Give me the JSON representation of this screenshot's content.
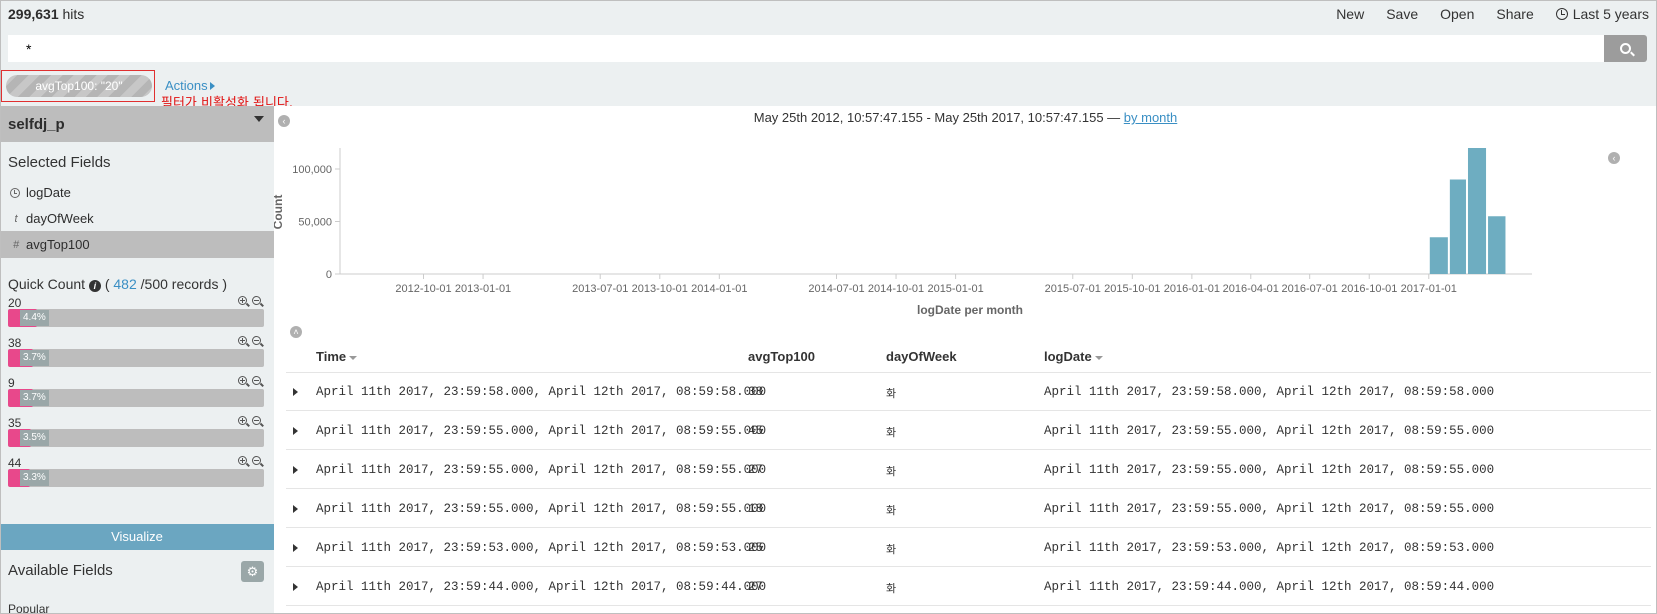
{
  "header": {
    "hits_count": "299,631",
    "hits_label": " hits",
    "nav": {
      "new": "New",
      "save": "Save",
      "open": "Open",
      "share": "Share",
      "time": "Last 5 years"
    }
  },
  "search": {
    "query": "*"
  },
  "filter": {
    "pill_label": "avgTop100: \"20\"",
    "actions_label": "Actions",
    "notice": "필터가 비활성화 됩니다."
  },
  "sidebar": {
    "index_name": "selfdj_p",
    "selected_title": "Selected Fields",
    "selected_fields": [
      {
        "name": "logDate",
        "type_icon": "clock-icon"
      },
      {
        "name": "dayOfWeek",
        "type_icon": "t"
      },
      {
        "name": "avgTop100",
        "type_icon": "#"
      }
    ],
    "quick_count": {
      "title": "Quick Count",
      "open": " ( ",
      "count": "482",
      "rest": " /500 records )"
    },
    "values": [
      {
        "label": "20",
        "pct": "4.4%",
        "fraction": 0.044
      },
      {
        "label": "38",
        "pct": "3.7%",
        "fraction": 0.037
      },
      {
        "label": "9",
        "pct": "3.7%",
        "fraction": 0.037
      },
      {
        "label": "35",
        "pct": "3.5%",
        "fraction": 0.035
      },
      {
        "label": "44",
        "pct": "3.3%",
        "fraction": 0.033
      }
    ],
    "visualize_label": "Visualize",
    "available_title": "Available Fields",
    "popular_label": "Popular"
  },
  "main": {
    "range_text": "May 25th 2012, 10:57:47.155 - May 25th 2017, 10:57:47.155 — ",
    "interval_link": "by month"
  },
  "chart_data": {
    "type": "bar",
    "xlabel": "logDate per month",
    "ylabel": "Count",
    "ylim": [
      0,
      120000
    ],
    "yticks": [
      0,
      50000,
      100000
    ],
    "ytick_labels": [
      "0",
      "50,000",
      "100,000"
    ],
    "xticks": [
      "2012-10-01",
      "2013-01-01",
      "2013-07-01",
      "2013-10-01",
      "2014-01-01",
      "2014-07-01",
      "2014-10-01",
      "2015-01-01",
      "2015-07-01",
      "2015-10-01",
      "2016-01-01",
      "2016-04-01",
      "2016-07-01",
      "2016-10-01",
      "2017-01-01"
    ],
    "categories": [
      "2017-01",
      "2017-02",
      "2017-03",
      "2017-04"
    ],
    "values": [
      35000,
      90000,
      120000,
      55000
    ],
    "color": "#6eadc1",
    "grid": false
  },
  "table": {
    "headers": {
      "time": "Time",
      "avgTop100": "avgTop100",
      "dayOfWeek": "dayOfWeek",
      "logDate": "logDate"
    },
    "rows": [
      {
        "time": "April 11th 2017, 23:59:58.000, April 12th 2017, 08:59:58.000",
        "avgTop100": "38",
        "dayOfWeek": "화",
        "logDate": "April 11th 2017, 23:59:58.000, April 12th 2017, 08:59:58.000"
      },
      {
        "time": "April 11th 2017, 23:59:55.000, April 12th 2017, 08:59:55.000",
        "avgTop100": "45",
        "dayOfWeek": "화",
        "logDate": "April 11th 2017, 23:59:55.000, April 12th 2017, 08:59:55.000"
      },
      {
        "time": "April 11th 2017, 23:59:55.000, April 12th 2017, 08:59:55.000",
        "avgTop100": "27",
        "dayOfWeek": "화",
        "logDate": "April 11th 2017, 23:59:55.000, April 12th 2017, 08:59:55.000"
      },
      {
        "time": "April 11th 2017, 23:59:55.000, April 12th 2017, 08:59:55.000",
        "avgTop100": "18",
        "dayOfWeek": "화",
        "logDate": "April 11th 2017, 23:59:55.000, April 12th 2017, 08:59:55.000"
      },
      {
        "time": "April 11th 2017, 23:59:53.000, April 12th 2017, 08:59:53.000",
        "avgTop100": "25",
        "dayOfWeek": "화",
        "logDate": "April 11th 2017, 23:59:53.000, April 12th 2017, 08:59:53.000"
      },
      {
        "time": "April 11th 2017, 23:59:44.000, April 12th 2017, 08:59:44.000",
        "avgTop100": "27",
        "dayOfWeek": "화",
        "logDate": "April 11th 2017, 23:59:44.000, April 12th 2017, 08:59:44.000"
      }
    ]
  }
}
